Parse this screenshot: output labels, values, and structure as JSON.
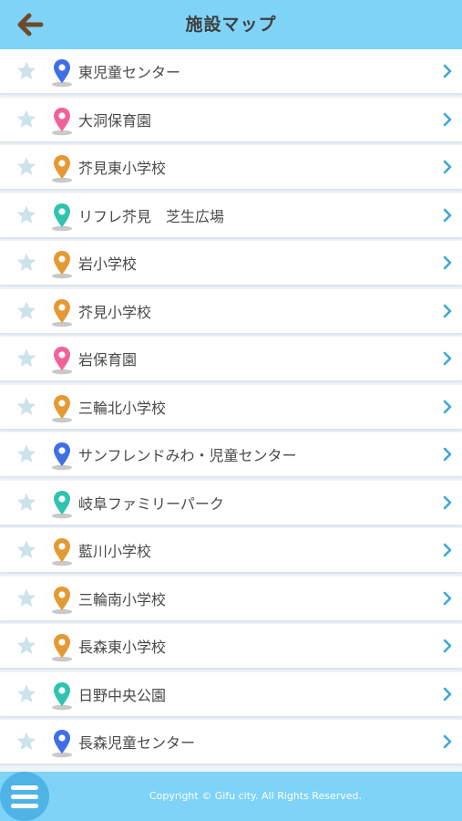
{
  "header": {
    "title": "施設マップ",
    "back_icon": "back-arrow-icon"
  },
  "colors": {
    "header_bg": "#7fd3f7",
    "blue": "#3f6fe6",
    "pink": "#f0639a",
    "orange": "#e39a33",
    "teal": "#2ec4b0",
    "star": "#cce3ec",
    "chevron": "#39a9dc"
  },
  "facilities": [
    {
      "name": "東児童センター",
      "pin_color": "blue"
    },
    {
      "name": "大洞保育園",
      "pin_color": "pink"
    },
    {
      "name": "芥見東小学校",
      "pin_color": "orange"
    },
    {
      "name": "リフレ芥見　芝生広場",
      "pin_color": "teal"
    },
    {
      "name": "岩小学校",
      "pin_color": "orange"
    },
    {
      "name": "芥見小学校",
      "pin_color": "orange"
    },
    {
      "name": "岩保育園",
      "pin_color": "pink"
    },
    {
      "name": "三輪北小学校",
      "pin_color": "orange"
    },
    {
      "name": "サンフレンドみわ・児童センター",
      "pin_color": "blue"
    },
    {
      "name": "岐阜ファミリーパーク",
      "pin_color": "teal"
    },
    {
      "name": "藍川小学校",
      "pin_color": "orange"
    },
    {
      "name": "三輪南小学校",
      "pin_color": "orange"
    },
    {
      "name": "長森東小学校",
      "pin_color": "orange"
    },
    {
      "name": "日野中央公園",
      "pin_color": "teal"
    },
    {
      "name": "長森児童センター",
      "pin_color": "blue"
    }
  ],
  "footer": {
    "copyright": "Copyright © Gifu city. All Rights Reserved.",
    "menu_icon": "hamburger-menu-icon"
  }
}
